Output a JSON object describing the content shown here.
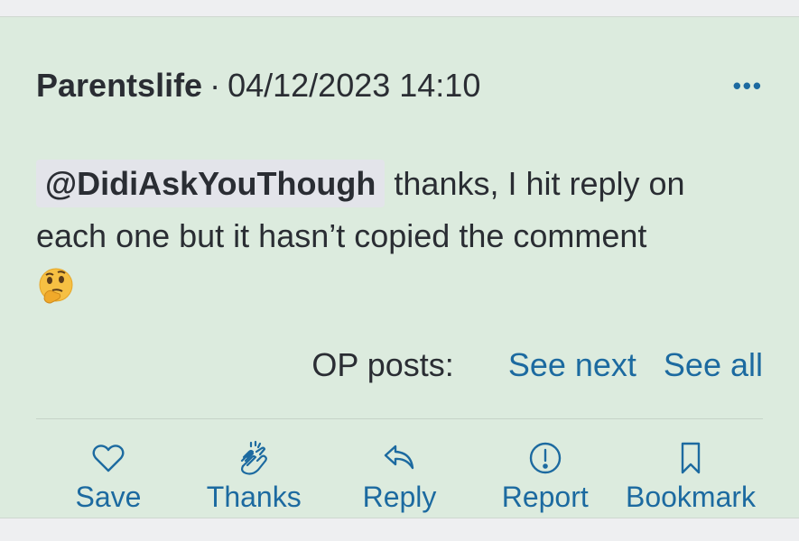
{
  "post": {
    "author": "Parentslife",
    "separator": "·",
    "timestamp": "04/12/2023 14:10",
    "more_icon": "more-horizontal-icon",
    "more_label": "•••",
    "mention": "@DidiAskYouThough",
    "body_text": " thanks, I hit reply on each one but it hasn’t copied the comment",
    "emoji": "thinking-face-emoji"
  },
  "op_posts": {
    "label": "OP posts:",
    "see_next": "See next",
    "see_all": "See all"
  },
  "actions": [
    {
      "label": "Save",
      "icon": "heart-icon"
    },
    {
      "label": "Thanks",
      "icon": "clapping-hands-icon"
    },
    {
      "label": "Reply",
      "icon": "reply-arrow-icon"
    },
    {
      "label": "Report",
      "icon": "exclamation-circle-icon"
    },
    {
      "label": "Bookmark",
      "icon": "bookmark-icon"
    }
  ],
  "colors": {
    "background": "#dcebde",
    "link": "#1c6aa0",
    "text": "#2a2d33",
    "mention_bg": "#e3e4ea"
  }
}
